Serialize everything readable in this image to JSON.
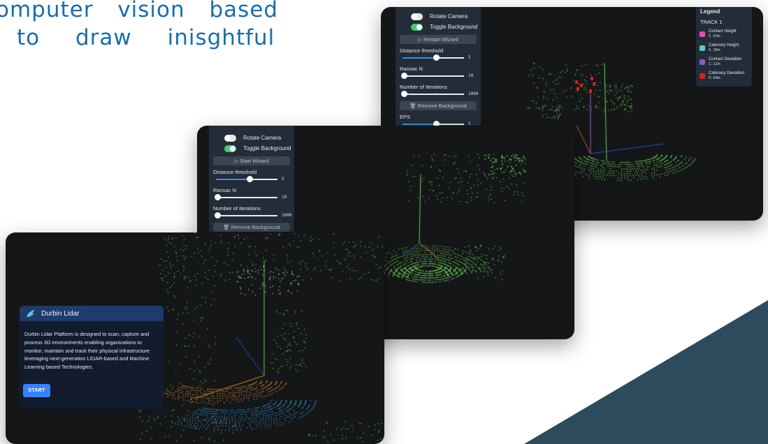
{
  "headline": {
    "line1": "omputer vision based",
    "line2": "to draw inisghtful"
  },
  "colors": {
    "headline": "#1b6da8",
    "accent_triangle": "#2e4b5e",
    "card_bg": "#141618",
    "panel_bg": "#232c38",
    "toggle_on": "#4ac777",
    "slider_fill": "#3b8fe2",
    "start_button": "#3b82f6",
    "point_green": "#6ed35a",
    "point_blue": "#3d9ad8",
    "point_orange": "#e0892f"
  },
  "back_panel": {
    "rotate_camera": "Rotate Camera",
    "toggle_background": "Toggle Background",
    "restart_wizard": "▷ Restart Wizard",
    "distance_threshold_label": "Distance threshold",
    "distance_threshold_value": "5",
    "distance_threshold_fraction": 0.55,
    "ransac_n_label": "Ransac N",
    "ransac_n_value": "10",
    "ransac_n_fraction": 0.02,
    "iterations_label": "Number of Iterations",
    "iterations_value": "1000",
    "iterations_fraction": 0.02,
    "remove_background": "🗑 Remove Background",
    "eps_label": "EPS",
    "eps_value": "5",
    "eps_fraction": 0.55
  },
  "legend": {
    "title": "Legend",
    "track": "TRACK 1",
    "items": [
      {
        "name": "Contact Height",
        "value": "5.63m",
        "color": "#e64fb2"
      },
      {
        "name": "Catenary Height",
        "value": "6.38m",
        "color": "#4fd1c5"
      },
      {
        "name": "Contact Deviation",
        "value": "1.12m",
        "color": "#8a5cb8"
      },
      {
        "name": "Catenary Deviation",
        "value": "0.84m",
        "color": "#e0201c"
      }
    ]
  },
  "mid_panel": {
    "rotate_camera": "Rotate Camera",
    "toggle_background": "Toggle Background",
    "start_wizard": "▷ Start Wizard",
    "distance_threshold_label": "Distance threshold",
    "distance_threshold_value": "5",
    "distance_threshold_fraction": 0.55,
    "ransac_n_label": "Ransac N",
    "ransac_n_value": "10",
    "ransac_n_fraction": 0.02,
    "iterations_label": "Number of Iterations",
    "iterations_value": "1000",
    "iterations_fraction": 0.02,
    "remove_background": "🗑 Remove Background"
  },
  "front_card": {
    "brand": "Durbin Lidar",
    "description": "Durbin Lidar Platform is designed to scan, capture and process 3D environments enabling organizations to monitor, maintain and track their physical infrastructure leveraging next-generation LIDAR-based and Machine Learning based Technologies.",
    "start_label": "START"
  }
}
